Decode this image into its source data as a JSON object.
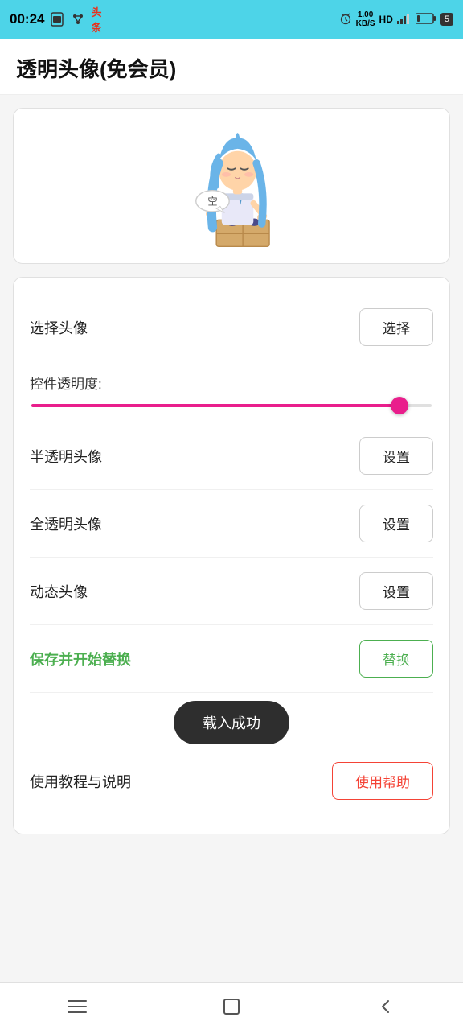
{
  "statusBar": {
    "time": "00:24",
    "rightIcons": [
      "alarm",
      "speed",
      "hd",
      "signal",
      "battery"
    ],
    "speedLabel": "1.00\nKB/S",
    "batteryLabel": "5"
  },
  "title": "透明头像(免会员)",
  "settings": {
    "selectAvatar": {
      "label": "选择头像",
      "buttonLabel": "选择"
    },
    "transparency": {
      "label": "控件透明度:",
      "value": 92
    },
    "semiTransparent": {
      "label": "半透明头像",
      "buttonLabel": "设置"
    },
    "fullTransparent": {
      "label": "全透明头像",
      "buttonLabel": "设置"
    },
    "dynamicAvatar": {
      "label": "动态头像",
      "buttonLabel": "设置"
    },
    "saveReplace": {
      "label": "保存并开始替换",
      "buttonLabel": "替换"
    },
    "toast": "载入成功",
    "helpTutorial": {
      "label": "使用教程与说明",
      "buttonLabel": "使用帮助"
    }
  },
  "navBar": {
    "items": [
      "menu-icon",
      "home-icon",
      "back-icon"
    ]
  }
}
